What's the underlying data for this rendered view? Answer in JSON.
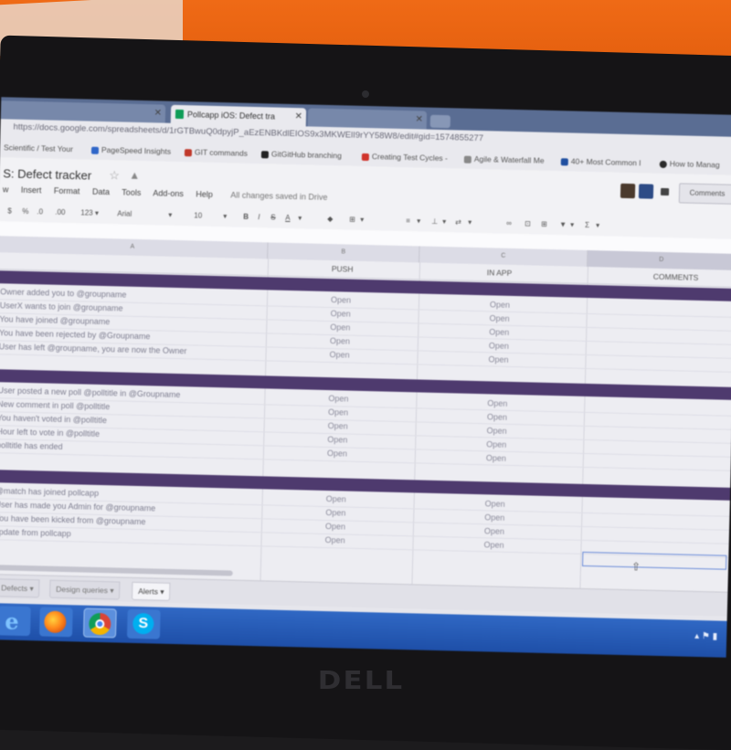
{
  "browser": {
    "tabs": [
      {
        "label": ""
      },
      {
        "label": "Pollcapp iOS: Defect tra"
      },
      {
        "label": ""
      }
    ],
    "url": "https://docs.google.com/spreadsheets/d/1rGTBwuQ0dpyjP_aEzENBKdlEIOS9x3MKWElI9rYY58W8/edit#gid=1574855277",
    "bookmarks": [
      {
        "label": "Scientific / Test Your",
        "color": "#b23b3b"
      },
      {
        "label": "PageSpeed Insights",
        "color": "#2f66c8"
      },
      {
        "label": "GIT commands",
        "color": "#c0392b"
      },
      {
        "label": "GitGitHub branching",
        "color": "#222222"
      },
      {
        "label": "Creating Test Cycles -",
        "color": "#d0342c"
      },
      {
        "label": "Agile & Waterfall Me",
        "color": "#888888"
      },
      {
        "label": "40+ Most Common I",
        "color": "#1f4fa0"
      },
      {
        "label": "How to Manag",
        "color": "#2b2b2b"
      }
    ]
  },
  "doc": {
    "title": "S: Defect tracker",
    "menus": [
      "w",
      "Insert",
      "Format",
      "Data",
      "Tools",
      "Add-ons",
      "Help"
    ],
    "save_status": "All changes saved in Drive",
    "comments_label": "Comments"
  },
  "toolbar": {
    "items": [
      "$",
      "%",
      ".0",
      ".00",
      "123 ▾",
      "Arial",
      "▾",
      "10",
      "▾",
      "B",
      "I",
      "S",
      "A",
      "▾",
      "⊞",
      "▾",
      "≡",
      "▾",
      "⊥",
      "▾",
      "⇄",
      "▾",
      "⊡",
      "⊞",
      "▾",
      "Σ",
      "▾"
    ]
  },
  "grid": {
    "column_letters": [
      "A",
      "B",
      "C",
      "D"
    ],
    "headers": {
      "push": "PUSH",
      "in_app": "IN APP",
      "comments": "COMMENTS"
    },
    "groups": [
      {
        "rows": [
          {
            "text": "Owner added you to @groupname",
            "push": "Open",
            "in_app": "Open"
          },
          {
            "text": "UserX wants to join @groupname",
            "push": "Open",
            "in_app": "Open"
          },
          {
            "text": "You have joined @groupname",
            "push": "Open",
            "in_app": "Open"
          },
          {
            "text": "You have been rejected by @Groupname",
            "push": "Open",
            "in_app": "Open"
          },
          {
            "text": "User has left @groupname, you are now the Owner",
            "push": "Open",
            "in_app": "Open"
          }
        ]
      },
      {
        "rows": [
          {
            "text": "User posted a new poll @polltitle in @Groupname",
            "push": "Open",
            "in_app": "Open"
          },
          {
            "text": "New comment in poll @polltitle",
            "push": "Open",
            "in_app": "Open"
          },
          {
            "text": "You haven't voted in @polltitle",
            "push": "Open",
            "in_app": "Open"
          },
          {
            "text": "Hour left to vote in @polltitle",
            "push": "Open",
            "in_app": "Open"
          },
          {
            "text": "polltitle has ended",
            "push": "Open",
            "in_app": "Open"
          }
        ]
      },
      {
        "rows": [
          {
            "text": "@match has joined pollcapp",
            "push": "Open",
            "in_app": "Open"
          },
          {
            "text": "User has made you Admin for @groupname",
            "push": "Open",
            "in_app": "Open"
          },
          {
            "text": "You have been kicked from @groupname",
            "push": "Open",
            "in_app": "Open"
          },
          {
            "text": "update from pollcapp",
            "push": "Open",
            "in_app": "Open"
          }
        ]
      }
    ]
  },
  "sheet_tabs": [
    {
      "label": "Defects",
      "active": false
    },
    {
      "label": "Design queries",
      "active": false
    },
    {
      "label": "Alerts",
      "active": true
    }
  ],
  "taskbar": {
    "apps": [
      "internet-explorer-icon",
      "firefox-icon",
      "chrome-icon",
      "skype-icon"
    ]
  },
  "hardware": {
    "brand": "DELL"
  }
}
